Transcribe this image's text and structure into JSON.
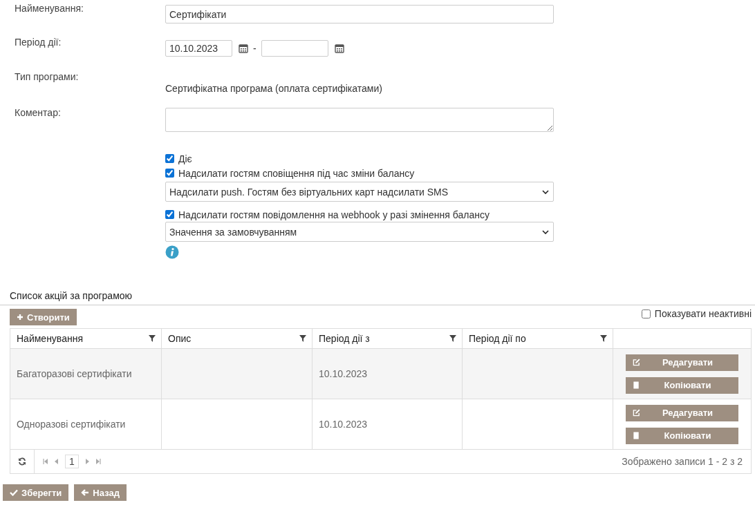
{
  "form": {
    "name": {
      "label": "Найменування:",
      "value": "Сертифікати"
    },
    "period": {
      "label": "Період дії:",
      "from": "10.10.2023",
      "separator": "-"
    },
    "program_type": {
      "label": "Тип програми:",
      "value": "Сертифікатна програма (оплата сертифікатами)"
    },
    "comment": {
      "label": "Коментар:"
    },
    "options": [
      {
        "kind": "checkbox",
        "label": "Діє",
        "checked": true
      },
      {
        "kind": "checkbox",
        "label": "Надсилати гостям сповіщення під час зміни балансу",
        "checked": true
      },
      {
        "kind": "select",
        "value": "Надсилати push. Гостям без віртуальних карт надсилати SMS"
      },
      {
        "kind": "checkbox",
        "label": "Надсилати гостям повідомлення на webhook у разі змінення балансу",
        "checked": true
      },
      {
        "kind": "select",
        "value": "Значення за замовчуванням"
      },
      {
        "kind": "info"
      }
    ]
  },
  "section": {
    "title": "Список акцій за програмою",
    "create_button": "Створити",
    "show_inactive": {
      "label": "Показувати неактивні",
      "checked": false
    }
  },
  "table": {
    "columns": [
      {
        "label": "Найменування"
      },
      {
        "label": "Опис"
      },
      {
        "label": "Період дії з"
      },
      {
        "label": "Період дії по"
      }
    ],
    "rows": [
      {
        "name": "Багаторазові сертифікати",
        "from": "10.10.2023",
        "actions": [
          {
            "kind": "edit",
            "label": "Редагувати"
          },
          {
            "kind": "copy",
            "label": "Копіювати"
          }
        ]
      },
      {
        "name": "Одноразові сертифікати",
        "from": "10.10.2023",
        "actions": [
          {
            "kind": "edit",
            "label": "Редагувати"
          },
          {
            "kind": "copy",
            "label": "Копіювати"
          }
        ]
      }
    ],
    "pager": {
      "page": "1",
      "summary": "Зображено записи 1 - 2 з 2"
    }
  },
  "buttons": [
    {
      "kind": "save",
      "label": "Зберегти"
    },
    {
      "kind": "back",
      "label": "Назад"
    }
  ]
}
